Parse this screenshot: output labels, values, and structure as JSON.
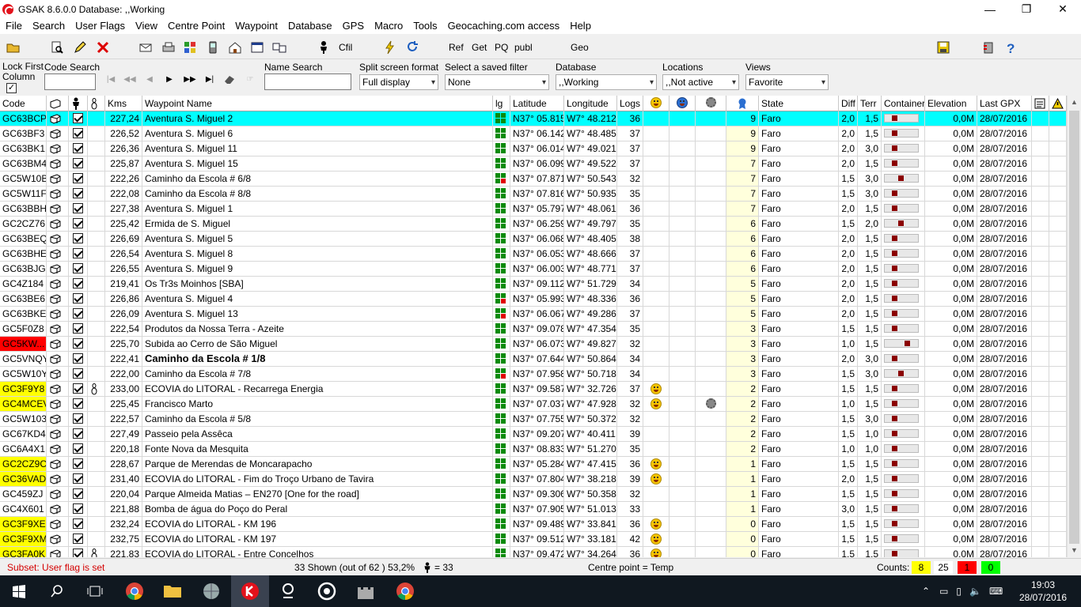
{
  "window": {
    "title": "GSAK 8.6.0.0    Database: ,,Working",
    "controls": {
      "minimize": "—",
      "restore": "❐",
      "close": "✕"
    }
  },
  "menu": [
    "File",
    "Search",
    "User Flags",
    "View",
    "Centre Point",
    "Waypoint",
    "Database",
    "GPS",
    "Macro",
    "Tools",
    "Geocaching.com access",
    "Help"
  ],
  "toolbar": {
    "cfil": "Cfil",
    "ref": "Ref",
    "get": "Get",
    "pq": "PQ",
    "publ": "publ",
    "geo": "Geo"
  },
  "filters": {
    "lock_first_column": "Lock First\nColumn",
    "lock_first_column_checked": true,
    "code_search_label": "Code Search",
    "code_search_value": "",
    "name_search_label": "Name Search",
    "name_search_value": "",
    "split_label": "Split screen format",
    "split_value": "Full display",
    "saved_filter_label": "Select a saved filter",
    "saved_filter_value": "None",
    "database_label": "Database",
    "database_value": ",,Working",
    "locations_label": "Locations",
    "locations_value": ",,Not active",
    "views_label": "Views",
    "views_value": "Favorite"
  },
  "columns": {
    "code": "Code",
    "kms": "Kms",
    "name": "Waypoint Name",
    "lg": "lg",
    "lat": "Latitude",
    "lon": "Longitude",
    "logs": "Logs",
    "state": "State",
    "diff": "Diff",
    "terr": "Terr",
    "container": "Container",
    "elevation": "Elevation",
    "last_gpx": "Last GPX"
  },
  "rows": [
    {
      "code": "GC63BCP",
      "code_bg": "",
      "kms": "227,24",
      "name": "Aventura S. Miguel 2",
      "bold": false,
      "lg": "gggg",
      "lat": "N37° 05.815",
      "lon": "W7° 48.212",
      "logs": "36",
      "smile": false,
      "gear": false,
      "fav": "9",
      "state": "Faro",
      "diff": "2,0",
      "terr": "1,5",
      "cont": 2,
      "elev": "0,0M",
      "gpx": "28/07/2016",
      "selected": true
    },
    {
      "code": "GC63BF3",
      "code_bg": "",
      "kms": "226,52",
      "name": "Aventura S. Miguel 6",
      "bold": false,
      "lg": "gggg",
      "lat": "N37° 06.142",
      "lon": "W7° 48.485",
      "logs": "37",
      "smile": false,
      "gear": false,
      "fav": "9",
      "state": "Faro",
      "diff": "2,0",
      "terr": "1,5",
      "cont": 2,
      "elev": "0,0M",
      "gpx": "28/07/2016"
    },
    {
      "code": "GC63BK1",
      "code_bg": "",
      "kms": "226,36",
      "name": "Aventura S. Miguel 11",
      "bold": false,
      "lg": "gggg",
      "lat": "N37° 06.014",
      "lon": "W7° 49.021",
      "logs": "37",
      "smile": false,
      "gear": false,
      "fav": "9",
      "state": "Faro",
      "diff": "2,0",
      "terr": "3,0",
      "cont": 2,
      "elev": "0,0M",
      "gpx": "28/07/2016"
    },
    {
      "code": "GC63BM4",
      "code_bg": "",
      "kms": "225,87",
      "name": "Aventura S. Miguel 15",
      "bold": false,
      "lg": "gggg",
      "lat": "N37° 06.099",
      "lon": "W7° 49.522",
      "logs": "37",
      "smile": false,
      "gear": false,
      "fav": "7",
      "state": "Faro",
      "diff": "2,0",
      "terr": "1,5",
      "cont": 2,
      "elev": "0,0M",
      "gpx": "28/07/2016"
    },
    {
      "code": "GC5W10B",
      "code_bg": "",
      "kms": "222,26",
      "name": "Caminho da Escola # 6/8",
      "bold": false,
      "lg": "gggr",
      "lat": "N37° 07.871",
      "lon": "W7° 50.543",
      "logs": "32",
      "smile": false,
      "gear": false,
      "fav": "7",
      "state": "Faro",
      "diff": "1,5",
      "terr": "3,0",
      "cont": 3,
      "elev": "0,0M",
      "gpx": "28/07/2016"
    },
    {
      "code": "GC5W11F",
      "code_bg": "",
      "kms": "222,08",
      "name": "Caminho da Escola # 8/8",
      "bold": false,
      "lg": "gggg",
      "lat": "N37° 07.816",
      "lon": "W7° 50.935",
      "logs": "35",
      "smile": false,
      "gear": false,
      "fav": "7",
      "state": "Faro",
      "diff": "1,5",
      "terr": "3,0",
      "cont": 2,
      "elev": "0,0M",
      "gpx": "28/07/2016"
    },
    {
      "code": "GC63BBH",
      "code_bg": "",
      "kms": "227,38",
      "name": "Aventura S. Miguel 1",
      "bold": false,
      "lg": "gggg",
      "lat": "N37° 05.797",
      "lon": "W7° 48.061",
      "logs": "36",
      "smile": false,
      "gear": false,
      "fav": "7",
      "state": "Faro",
      "diff": "2,0",
      "terr": "1,5",
      "cont": 2,
      "elev": "0,0M",
      "gpx": "28/07/2016"
    },
    {
      "code": "GC2CZ76",
      "code_bg": "",
      "kms": "225,42",
      "name": "Ermida de S. Miguel",
      "bold": false,
      "lg": "gggg",
      "lat": "N37° 06.259",
      "lon": "W7° 49.797",
      "logs": "35",
      "smile": false,
      "gear": false,
      "fav": "6",
      "state": "Faro",
      "diff": "1,5",
      "terr": "2,0",
      "cont": 3,
      "elev": "0,0M",
      "gpx": "28/07/2016"
    },
    {
      "code": "GC63BEQ",
      "code_bg": "",
      "kms": "226,69",
      "name": "Aventura S. Miguel 5",
      "bold": false,
      "lg": "gggg",
      "lat": "N37° 06.068",
      "lon": "W7° 48.405",
      "logs": "38",
      "smile": false,
      "gear": false,
      "fav": "6",
      "state": "Faro",
      "diff": "2,0",
      "terr": "1,5",
      "cont": 2,
      "elev": "0,0M",
      "gpx": "28/07/2016"
    },
    {
      "code": "GC63BHE",
      "code_bg": "",
      "kms": "226,54",
      "name": "Aventura S. Miguel 8",
      "bold": false,
      "lg": "gggg",
      "lat": "N37° 06.053",
      "lon": "W7° 48.666",
      "logs": "37",
      "smile": false,
      "gear": false,
      "fav": "6",
      "state": "Faro",
      "diff": "2,0",
      "terr": "1,5",
      "cont": 2,
      "elev": "0,0M",
      "gpx": "28/07/2016"
    },
    {
      "code": "GC63BJG",
      "code_bg": "",
      "kms": "226,55",
      "name": "Aventura S. Miguel 9",
      "bold": false,
      "lg": "gggg",
      "lat": "N37° 06.003",
      "lon": "W7° 48.771",
      "logs": "37",
      "smile": false,
      "gear": false,
      "fav": "6",
      "state": "Faro",
      "diff": "2,0",
      "terr": "1,5",
      "cont": 2,
      "elev": "0,0M",
      "gpx": "28/07/2016"
    },
    {
      "code": "GC4Z184",
      "code_bg": "",
      "kms": "219,41",
      "name": "Os Tr3s Moinhos [SBA]",
      "bold": false,
      "lg": "gggg",
      "lat": "N37° 09.112",
      "lon": "W7° 51.729",
      "logs": "34",
      "smile": false,
      "gear": false,
      "fav": "5",
      "state": "Faro",
      "diff": "2,0",
      "terr": "1,5",
      "cont": 2,
      "elev": "0,0M",
      "gpx": "28/07/2016"
    },
    {
      "code": "GC63BE6",
      "code_bg": "",
      "kms": "226,86",
      "name": "Aventura S. Miguel 4",
      "bold": false,
      "lg": "gggr",
      "lat": "N37° 05.993",
      "lon": "W7° 48.336",
      "logs": "36",
      "smile": false,
      "gear": false,
      "fav": "5",
      "state": "Faro",
      "diff": "2,0",
      "terr": "1,5",
      "cont": 2,
      "elev": "0,0M",
      "gpx": "28/07/2016"
    },
    {
      "code": "GC63BKE",
      "code_bg": "",
      "kms": "226,09",
      "name": "Aventura S. Miguel 13",
      "bold": false,
      "lg": "gggr",
      "lat": "N37° 06.067",
      "lon": "W7° 49.286",
      "logs": "37",
      "smile": false,
      "gear": false,
      "fav": "5",
      "state": "Faro",
      "diff": "2,0",
      "terr": "1,5",
      "cont": 2,
      "elev": "0,0M",
      "gpx": "28/07/2016"
    },
    {
      "code": "GC5F0Z8",
      "code_bg": "",
      "kms": "222,54",
      "name": "Produtos da Nossa Terra - Azeite",
      "bold": false,
      "lg": "gggg",
      "lat": "N37° 09.078",
      "lon": "W7° 47.354",
      "logs": "35",
      "smile": false,
      "gear": false,
      "fav": "3",
      "state": "Faro",
      "diff": "1,5",
      "terr": "1,5",
      "cont": 2,
      "elev": "0,0M",
      "gpx": "28/07/2016"
    },
    {
      "code": "GC5KW...",
      "code_bg": "#ff0000",
      "kms": "225,70",
      "name": "Subida ao Cerro de São Miguel",
      "bold": false,
      "lg": "gggg",
      "lat": "N37° 06.073",
      "lon": "W7° 49.827",
      "logs": "32",
      "smile": false,
      "gear": false,
      "fav": "3",
      "state": "Faro",
      "diff": "1,0",
      "terr": "1,5",
      "cont": 4,
      "elev": "0,0M",
      "gpx": "28/07/2016"
    },
    {
      "code": "GC5VNQY",
      "code_bg": "",
      "kms": "222,41",
      "name": "Caminho da Escola # 1/8",
      "bold": true,
      "lg": "gggg",
      "lat": "N37° 07.644",
      "lon": "W7° 50.864",
      "logs": "34",
      "smile": false,
      "gear": false,
      "fav": "3",
      "state": "Faro",
      "diff": "2,0",
      "terr": "3,0",
      "cont": 2,
      "elev": "0,0M",
      "gpx": "28/07/2016"
    },
    {
      "code": "GC5W10Y",
      "code_bg": "",
      "kms": "222,00",
      "name": "Caminho da Escola # 7/8",
      "bold": false,
      "lg": "gggr",
      "lat": "N37° 07.958",
      "lon": "W7° 50.718",
      "logs": "34",
      "smile": false,
      "gear": false,
      "fav": "3",
      "state": "Faro",
      "diff": "1,5",
      "terr": "3,0",
      "cont": 3,
      "elev": "0,0M",
      "gpx": "28/07/2016"
    },
    {
      "code": "GC3F9Y8",
      "code_bg": "#ffff00",
      "kms": "233,00",
      "name": "ECOVIA do LITORAL - Recarrega Energia",
      "bold": false,
      "lg": "gggg",
      "lat": "N37° 09.587",
      "lon": "W7° 32.726",
      "logs": "37",
      "smile": true,
      "gear": false,
      "fav": "2",
      "state": "Faro",
      "diff": "1,5",
      "terr": "1,5",
      "cont": 2,
      "elev": "0,0M",
      "gpx": "28/07/2016",
      "travel": true
    },
    {
      "code": "GC4MCEV",
      "code_bg": "#ffff00",
      "kms": "225,45",
      "name": "Francisco Marto",
      "bold": false,
      "lg": "gggg",
      "lat": "N37° 07.037",
      "lon": "W7° 47.928",
      "logs": "32",
      "smile": true,
      "gear": true,
      "fav": "2",
      "state": "Faro",
      "diff": "1,0",
      "terr": "1,5",
      "cont": 2,
      "elev": "0,0M",
      "gpx": "28/07/2016"
    },
    {
      "code": "GC5W103",
      "code_bg": "",
      "kms": "222,57",
      "name": "Caminho da Escola # 5/8",
      "bold": false,
      "lg": "gggg",
      "lat": "N37° 07.755",
      "lon": "W7° 50.372",
      "logs": "32",
      "smile": false,
      "gear": false,
      "fav": "2",
      "state": "Faro",
      "diff": "1,5",
      "terr": "3,0",
      "cont": 2,
      "elev": "0,0M",
      "gpx": "28/07/2016"
    },
    {
      "code": "GC67KD4",
      "code_bg": "",
      "kms": "227,49",
      "name": "Passeio pela Assêca",
      "bold": false,
      "lg": "gggg",
      "lat": "N37° 09.207",
      "lon": "W7° 40.411",
      "logs": "39",
      "smile": false,
      "gear": false,
      "fav": "2",
      "state": "Faro",
      "diff": "1,5",
      "terr": "1,0",
      "cont": 2,
      "elev": "0,0M",
      "gpx": "28/07/2016"
    },
    {
      "code": "GC6A4X1",
      "code_bg": "",
      "kms": "220,18",
      "name": "Fonte Nova da Mesquita",
      "bold": false,
      "lg": "gggg",
      "lat": "N37° 08.833",
      "lon": "W7° 51.270",
      "logs": "35",
      "smile": false,
      "gear": false,
      "fav": "2",
      "state": "Faro",
      "diff": "1,0",
      "terr": "1,0",
      "cont": 2,
      "elev": "0,0M",
      "gpx": "28/07/2016"
    },
    {
      "code": "GC2CZ9C",
      "code_bg": "#ffff00",
      "kms": "228,67",
      "name": "Parque de Merendas de Moncarapacho",
      "bold": false,
      "lg": "gggg",
      "lat": "N37° 05.284",
      "lon": "W7° 47.415",
      "logs": "36",
      "smile": true,
      "gear": false,
      "fav": "1",
      "state": "Faro",
      "diff": "1,5",
      "terr": "1,5",
      "cont": 2,
      "elev": "0,0M",
      "gpx": "28/07/2016"
    },
    {
      "code": "GC36VAD",
      "code_bg": "#ffff00",
      "kms": "231,40",
      "name": "ECOVIA do LITORAL - Fim do Troço Urbano de Tavira",
      "bold": false,
      "lg": "gggg",
      "lat": "N37° 07.804",
      "lon": "W7° 38.218",
      "logs": "39",
      "smile": true,
      "gear": false,
      "fav": "1",
      "state": "Faro",
      "diff": "2,0",
      "terr": "1,5",
      "cont": 2,
      "elev": "0,0M",
      "gpx": "28/07/2016"
    },
    {
      "code": "GC459ZJ",
      "code_bg": "",
      "kms": "220,04",
      "name": "Parque Almeida Matias – EN270 [One for the road]",
      "bold": false,
      "lg": "gggg",
      "lat": "N37° 09.306",
      "lon": "W7° 50.358",
      "logs": "32",
      "smile": false,
      "gear": false,
      "fav": "1",
      "state": "Faro",
      "diff": "1,5",
      "terr": "1,5",
      "cont": 2,
      "elev": "0,0M",
      "gpx": "28/07/2016"
    },
    {
      "code": "GC4X601",
      "code_bg": "",
      "kms": "221,88",
      "name": "Bomba de água do Poço do Peral",
      "bold": false,
      "lg": "gggg",
      "lat": "N37° 07.905",
      "lon": "W7° 51.013",
      "logs": "33",
      "smile": false,
      "gear": false,
      "fav": "1",
      "state": "Faro",
      "diff": "3,0",
      "terr": "1,5",
      "cont": 2,
      "elev": "0,0M",
      "gpx": "28/07/2016"
    },
    {
      "code": "GC3F9XE",
      "code_bg": "#ffff00",
      "kms": "232,24",
      "name": "ECOVIA do LITORAL - KM 196",
      "bold": false,
      "lg": "gggg",
      "lat": "N37° 09.489",
      "lon": "W7° 33.841",
      "logs": "36",
      "smile": true,
      "gear": false,
      "fav": "0",
      "state": "Faro",
      "diff": "1,5",
      "terr": "1,5",
      "cont": 2,
      "elev": "0,0M",
      "gpx": "28/07/2016"
    },
    {
      "code": "GC3F9XM",
      "code_bg": "#ffff00",
      "kms": "232,75",
      "name": "ECOVIA do LITORAL - KM 197",
      "bold": false,
      "lg": "gggg",
      "lat": "N37° 09.512",
      "lon": "W7° 33.181",
      "logs": "42",
      "smile": true,
      "gear": false,
      "fav": "0",
      "state": "Faro",
      "diff": "1,5",
      "terr": "1,5",
      "cont": 2,
      "elev": "0,0M",
      "gpx": "28/07/2016"
    },
    {
      "code": "GC3FA0K",
      "code_bg": "#ffff00",
      "kms": "221,83",
      "name": "ECOVIA do LITORAL - Entre Concelhos",
      "bold": false,
      "lg": "gggg",
      "lat": "N37° 09.472",
      "lon": "W7° 34.264",
      "logs": "36",
      "smile": true,
      "gear": false,
      "fav": "0",
      "state": "Faro",
      "diff": "1,5",
      "terr": "1,5",
      "cont": 2,
      "elev": "0,0M",
      "gpx": "28/07/2016",
      "travel": true
    }
  ],
  "status": {
    "subset": "Subset: User flag is set",
    "shown": "33 Shown (out of 62 )  53,2%",
    "user_count": "= 33",
    "centre": "Centre point = Temp",
    "counts_label": "Counts:",
    "count_yellow": "8",
    "count_white": "25",
    "count_red": "1",
    "count_green": "0"
  },
  "taskbar": {
    "time": "19:03",
    "date": "28/07/2016"
  },
  "colors": {
    "selected_row": "#00ffff",
    "yellow_flag": "#ffff00",
    "red_flag": "#ff0000",
    "green_count": "#00ff00",
    "favorite_col": "#ffffdc"
  }
}
